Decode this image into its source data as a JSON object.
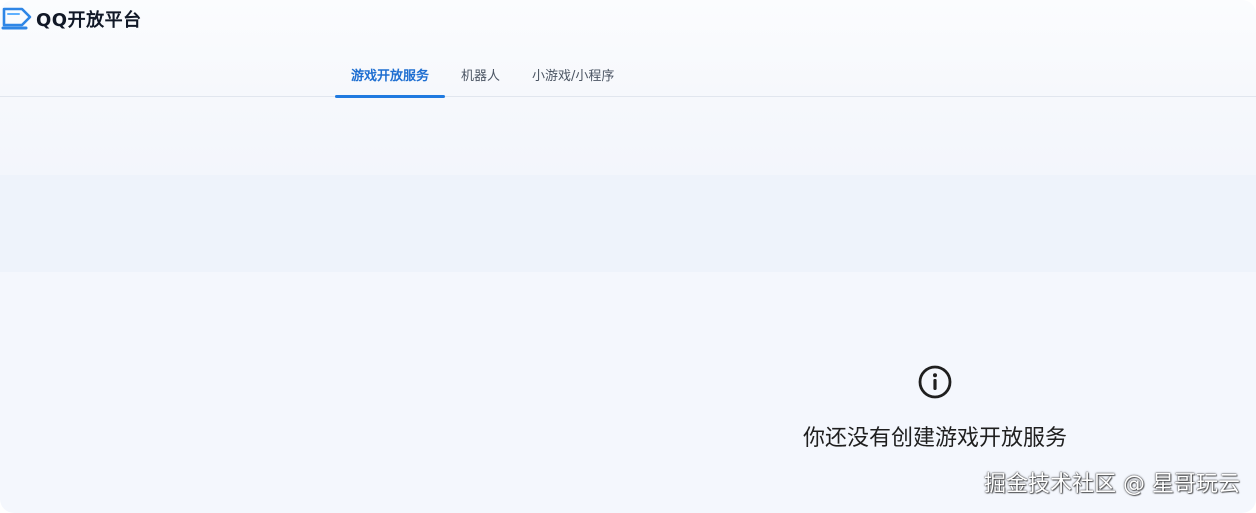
{
  "app": {
    "logo_text": "QQ开放平台",
    "logo_icon": "qq-logo-icon"
  },
  "tabs": [
    {
      "label": "游戏开放服务",
      "active": true
    },
    {
      "label": "机器人",
      "active": false
    },
    {
      "label": "小游戏/小程序",
      "active": false
    }
  ],
  "empty_state": {
    "icon": "info-icon",
    "message": "你还没有创建游戏开放服务"
  },
  "watermark": {
    "text": "掘金技术社区 @ 星哥玩云"
  },
  "colors": {
    "accent": "#1f7ae0",
    "active_tab_text": "#1f6fd1",
    "logo_blue": "#2f86e6"
  }
}
